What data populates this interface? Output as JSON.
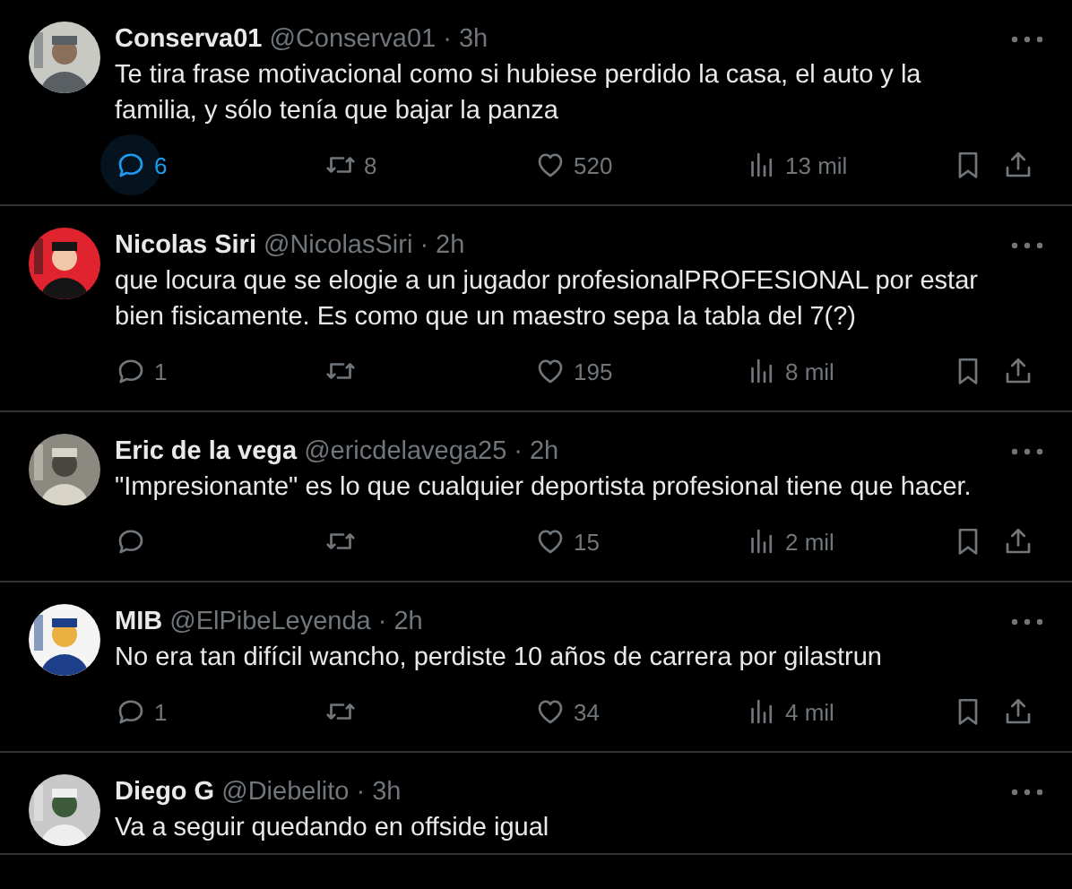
{
  "tweets": [
    {
      "name": "Conserva01",
      "handle": "@Conserva01",
      "separator": "·",
      "time": "3h",
      "text": "Te tira frase motivacional como si hubiese perdido la casa, el auto y la familia, y sólo tenía que bajar la panza",
      "actions": [
        {
          "kind": "reply",
          "count": "6",
          "highlighted": true
        },
        {
          "kind": "retweet",
          "count": "8",
          "highlighted": false
        },
        {
          "kind": "like",
          "count": "520",
          "highlighted": false
        },
        {
          "kind": "views",
          "count": "13 mil",
          "highlighted": false
        },
        {
          "kind": "bookmark",
          "highlighted": false
        },
        {
          "kind": "share",
          "highlighted": false
        }
      ]
    },
    {
      "name": "Nicolas Siri",
      "handle": "@NicolasSiri",
      "separator": "·",
      "time": "2h",
      "text": "que locura que se elogie a un jugador profesionalPROFESIONAL por estar bien fisicamente. Es como que un maestro sepa la tabla del 7(?)",
      "actions": [
        {
          "kind": "reply",
          "count": "1",
          "highlighted": false
        },
        {
          "kind": "retweet",
          "highlighted": false
        },
        {
          "kind": "like",
          "count": "195",
          "highlighted": false
        },
        {
          "kind": "views",
          "count": "8 mil",
          "highlighted": false
        },
        {
          "kind": "bookmark",
          "highlighted": false
        },
        {
          "kind": "share",
          "highlighted": false
        }
      ]
    },
    {
      "name": "Eric de la vega",
      "handle": "@ericdelavega25",
      "separator": "·",
      "time": "2h",
      "text": "\"Impresionante\" es lo que cualquier deportista profesional tiene que hacer.",
      "actions": [
        {
          "kind": "reply",
          "highlighted": false
        },
        {
          "kind": "retweet",
          "highlighted": false
        },
        {
          "kind": "like",
          "count": "15",
          "highlighted": false
        },
        {
          "kind": "views",
          "count": "2 mil",
          "highlighted": false
        },
        {
          "kind": "bookmark",
          "highlighted": false
        },
        {
          "kind": "share",
          "highlighted": false
        }
      ]
    },
    {
      "name": "MIB",
      "handle": "@ElPibeLeyenda",
      "separator": "·",
      "time": "2h",
      "text": "No era tan difícil wancho, perdiste 10 años de carrera por gilastrun",
      "actions": [
        {
          "kind": "reply",
          "count": "1",
          "highlighted": false
        },
        {
          "kind": "retweet",
          "highlighted": false
        },
        {
          "kind": "like",
          "count": "34",
          "highlighted": false
        },
        {
          "kind": "views",
          "count": "4 mil",
          "highlighted": false
        },
        {
          "kind": "bookmark",
          "highlighted": false
        },
        {
          "kind": "share",
          "highlighted": false
        }
      ]
    },
    {
      "name": "Diego G",
      "handle": "@Diebelito",
      "separator": "·",
      "time": "3h",
      "text": "Va a seguir quedando en offside igual"
    }
  ]
}
